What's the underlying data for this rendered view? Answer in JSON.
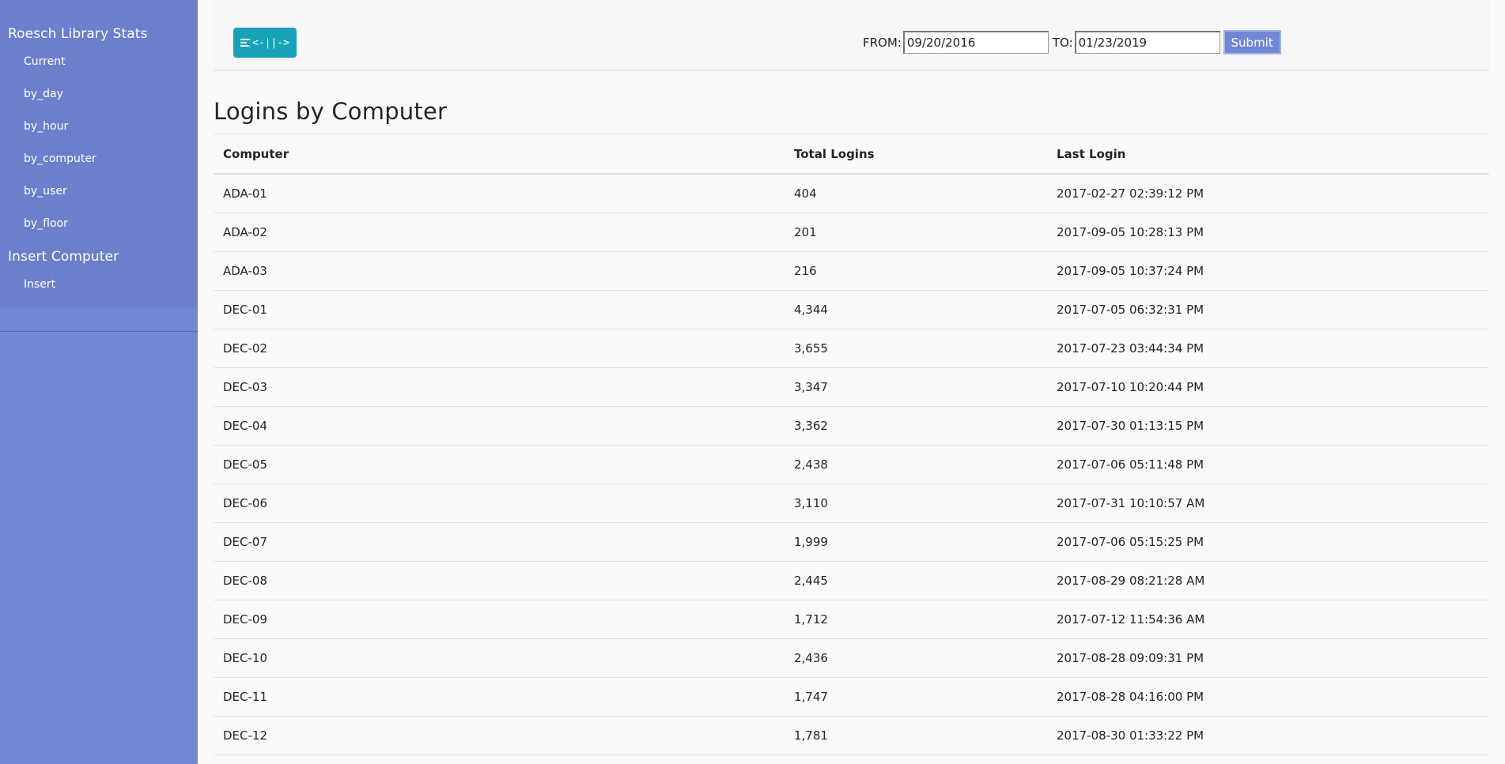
{
  "sidebar": {
    "heading1": "Roesch Library Stats",
    "items1": [
      {
        "label": "Current"
      },
      {
        "label": "by_day"
      },
      {
        "label": "by_hour"
      },
      {
        "label": "by_computer"
      },
      {
        "label": "by_user"
      },
      {
        "label": "by_floor"
      }
    ],
    "heading2": "Insert Computer",
    "items2": [
      {
        "label": "Insert"
      }
    ]
  },
  "toolbar": {
    "toggle_label": "<-||->",
    "from_label": "FROM:",
    "from_value": "09/20/2016",
    "to_label": "TO:",
    "to_value": "01/23/2019",
    "submit_label": "Submit"
  },
  "page_title": "Logins by Computer",
  "table": {
    "headers": [
      "Computer",
      "Total Logins",
      "Last Login"
    ],
    "rows": [
      [
        "ADA-01",
        "404",
        "2017-02-27 02:39:12 PM"
      ],
      [
        "ADA-02",
        "201",
        "2017-09-05 10:28:13 PM"
      ],
      [
        "ADA-03",
        "216",
        "2017-09-05 10:37:24 PM"
      ],
      [
        "DEC-01",
        "4,344",
        "2017-07-05 06:32:31 PM"
      ],
      [
        "DEC-02",
        "3,655",
        "2017-07-23 03:44:34 PM"
      ],
      [
        "DEC-03",
        "3,347",
        "2017-07-10 10:20:44 PM"
      ],
      [
        "DEC-04",
        "3,362",
        "2017-07-30 01:13:15 PM"
      ],
      [
        "DEC-05",
        "2,438",
        "2017-07-06 05:11:48 PM"
      ],
      [
        "DEC-06",
        "3,110",
        "2017-07-31 10:10:57 AM"
      ],
      [
        "DEC-07",
        "1,999",
        "2017-07-06 05:15:25 PM"
      ],
      [
        "DEC-08",
        "2,445",
        "2017-08-29 08:21:28 AM"
      ],
      [
        "DEC-09",
        "1,712",
        "2017-07-12 11:54:36 AM"
      ],
      [
        "DEC-10",
        "2,436",
        "2017-08-28 09:09:31 PM"
      ],
      [
        "DEC-11",
        "1,747",
        "2017-08-28 04:16:00 PM"
      ],
      [
        "DEC-12",
        "1,781",
        "2017-08-30 01:33:22 PM"
      ]
    ]
  }
}
